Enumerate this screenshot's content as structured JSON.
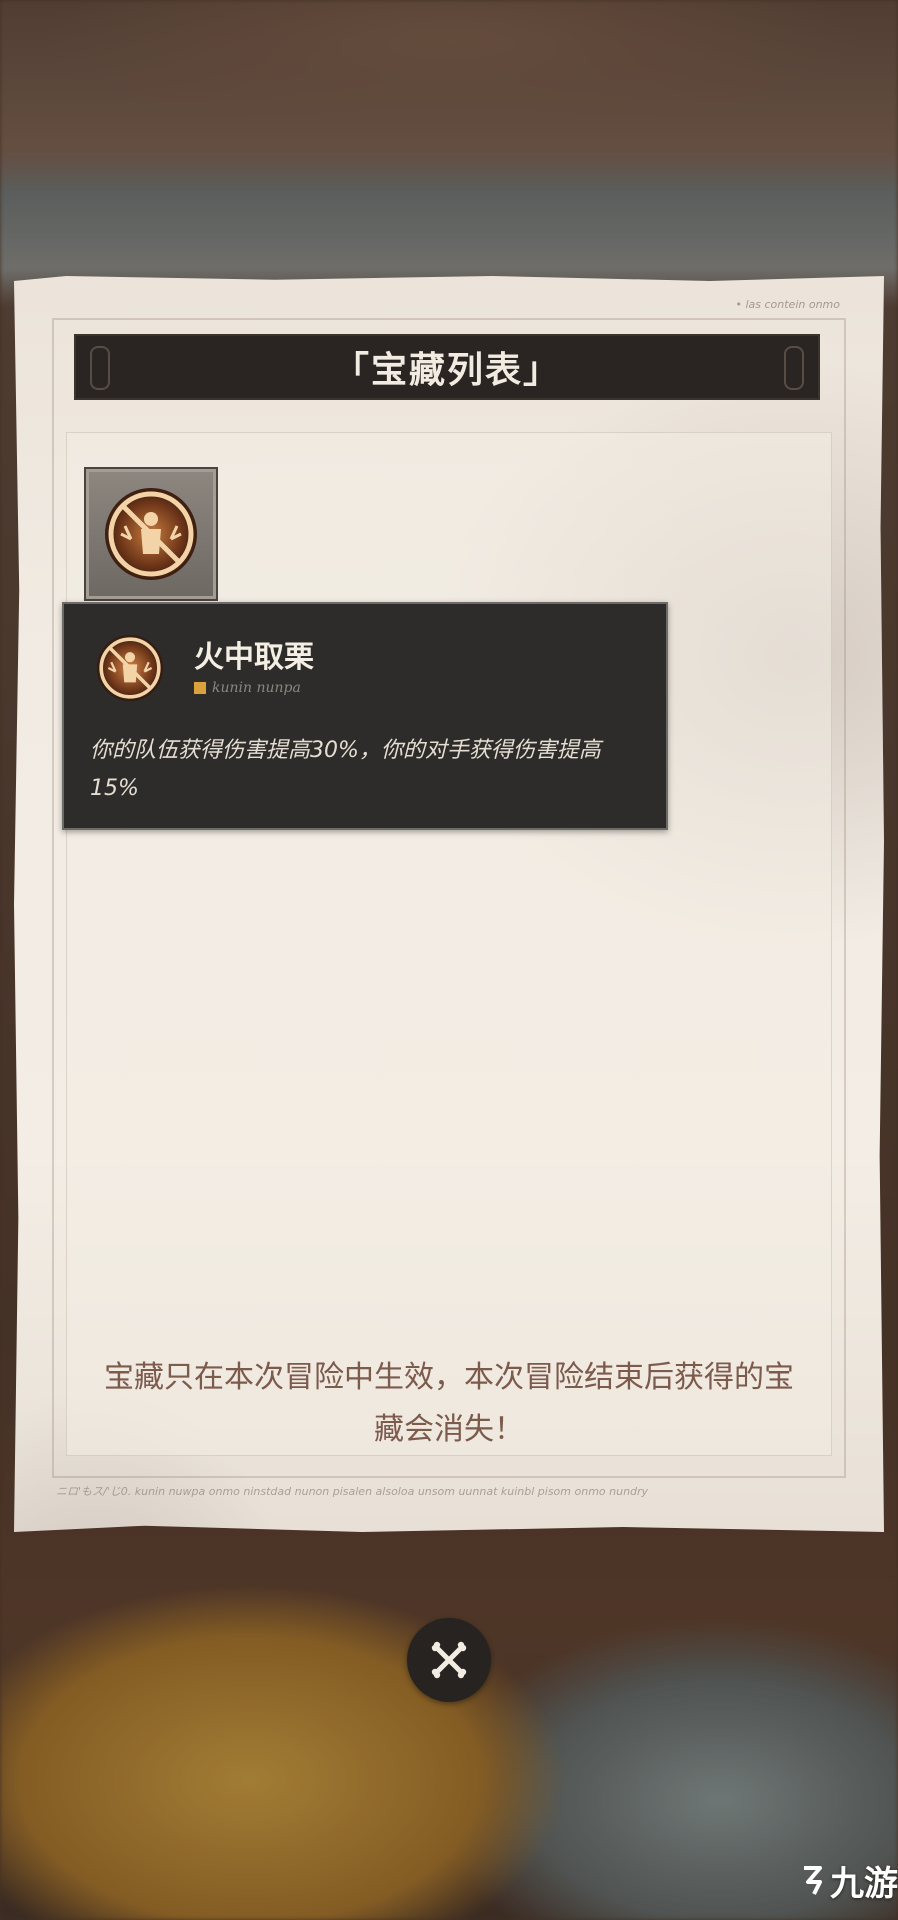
{
  "modal": {
    "title": "「宝藏列表」",
    "paper_tag": "• las contein onmo"
  },
  "treasure_slot": {
    "icon": "treasure-medal-icon"
  },
  "tooltip": {
    "name": "火中取栗",
    "subtitle": "kunin nunpa",
    "description": "你的队伍获得伤害提高30%，你的对手获得伤害提高15%"
  },
  "note": {
    "text": "宝藏只在本次冒险中生效，本次冒险结束后获得的宝藏会消失！"
  },
  "paper_footer": {
    "text": "ニロ'もス/'じ0.  kunin nuwpa onmo ninstdad nunon pisalen alsoloa unsom uunnat kuinbl pisom onmo nundry"
  },
  "close_button": {
    "icon": "close-crossed-bones-icon"
  },
  "watermark": {
    "text": "九游"
  },
  "colors": {
    "banner_bg": "#2a2522",
    "tooltip_bg": "#2e2c2a",
    "note_text": "#7c5a4c",
    "medal_glow": "#e9a35a"
  }
}
